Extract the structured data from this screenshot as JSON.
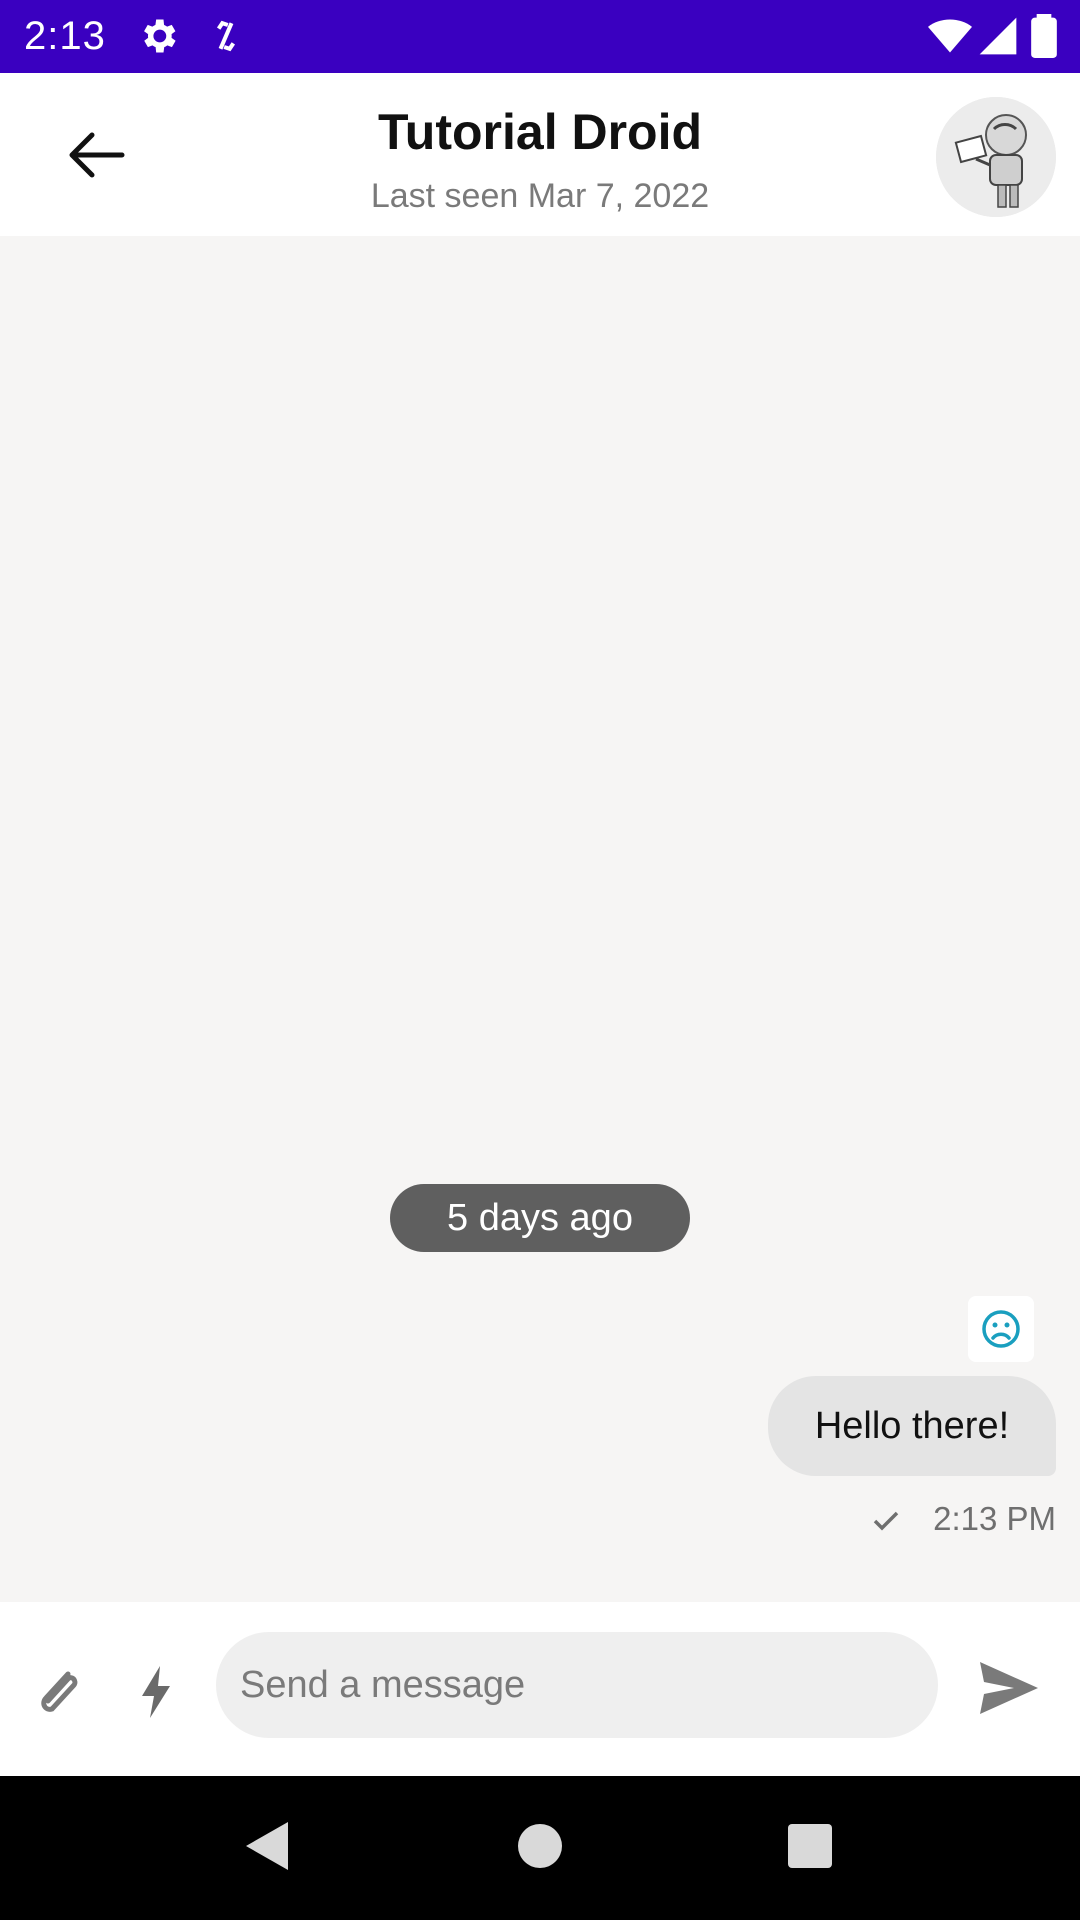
{
  "status_bar": {
    "time": "2:13",
    "icons": [
      "settings-icon",
      "sync-icon",
      "wifi-icon",
      "signal-icon",
      "battery-icon"
    ],
    "background": "#3a00c0"
  },
  "header": {
    "title": "Tutorial Droid",
    "subtitle": "Last seen Mar 7, 2022",
    "back_icon": "arrow-back-icon",
    "avatar": "robot-avatar"
  },
  "messages": {
    "date_separator": "5 days ago",
    "items": [
      {
        "text": "Hello there!",
        "time": "2:13 PM",
        "status_icon": "check-icon",
        "reaction_icon": "sad-face-icon",
        "reaction_color": "#1a9fbf"
      }
    ]
  },
  "composer": {
    "placeholder": "Send a message",
    "value": "",
    "attach_icon": "paperclip-icon",
    "commands_icon": "lightning-icon",
    "send_icon": "send-icon"
  },
  "nav_bar": {
    "buttons": [
      "back-triangle-icon",
      "home-circle-icon",
      "recents-square-icon"
    ]
  }
}
